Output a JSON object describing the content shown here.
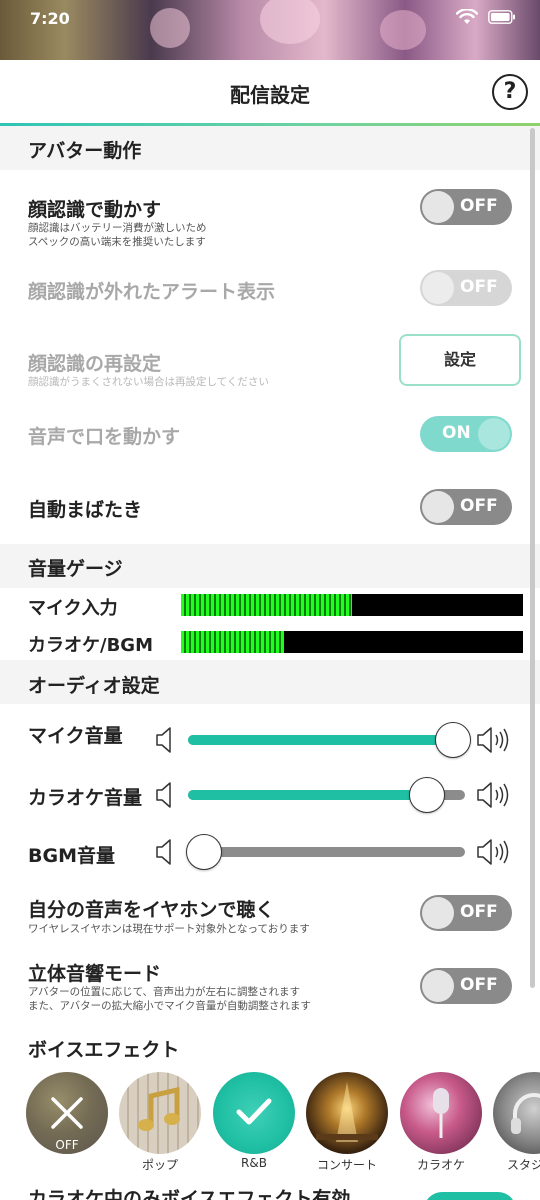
{
  "status": {
    "time": "7:20"
  },
  "header": {
    "title": "配信設定",
    "help": "?"
  },
  "sections": {
    "avatar": "アバター動作",
    "meter": "音量ゲージ",
    "audio": "オーディオ設定",
    "voice_effect": "ボイスエフェクト"
  },
  "avatar": {
    "face_move": {
      "title": "顔認識で動かす",
      "desc1": "顔認識はバッテリー消費が激しいため",
      "desc2": "スペックの高い端末を推奨いたします",
      "state": "OFF"
    },
    "face_alert": {
      "title": "顔認識が外れたアラート表示",
      "state": "OFF"
    },
    "face_reset": {
      "title": "顔認識の再設定",
      "desc": "顔認識がうまくされない場合は再設定してください",
      "button": "設定"
    },
    "mouth": {
      "title": "音声で口を動かす",
      "state": "ON"
    },
    "blink": {
      "title": "自動まばたき",
      "state": "OFF"
    }
  },
  "meters": {
    "mic": {
      "label": "マイク入力",
      "level": 0.5
    },
    "karaoke": {
      "label": "カラオケ/BGM",
      "level": 0.3
    }
  },
  "audio": {
    "mic_volume": {
      "label": "マイク音量",
      "value": 1.0
    },
    "karaoke_volume": {
      "label": "カラオケ音量",
      "value": 0.9
    },
    "bgm_volume": {
      "label": "BGM音量",
      "value": 0.06
    },
    "monitor": {
      "title": "自分の音声をイヤホンで聴く",
      "desc": "ワイヤレスイヤホンは現在サポート対象外となっております",
      "state": "OFF"
    },
    "stereo": {
      "title": "立体音響モード",
      "desc1": "アバターの位置に応じて、音声出力が左右に調整されます",
      "desc2": "また、アバターの拡大縮小でマイク音量が自動調整されます",
      "state": "OFF"
    }
  },
  "effects": [
    {
      "label": "OFF",
      "icon": "close-icon",
      "selected": false
    },
    {
      "label": "ポップ",
      "icon": "music-note-icon",
      "selected": false
    },
    {
      "label": "R&B",
      "icon": "check-icon",
      "selected": true
    },
    {
      "label": "コンサート",
      "icon": "stage-icon",
      "selected": false
    },
    {
      "label": "カラオケ",
      "icon": "microphone-icon",
      "selected": false
    },
    {
      "label": "スタジ",
      "icon": "headphones-icon",
      "selected": false
    }
  ],
  "bottom": {
    "title": "カラオケ中のみボイスエフェクト有効"
  },
  "colors": {
    "accent": "#1fbfa3",
    "meter_green": "#1fff1f",
    "toggle_off": "#8a8a8a"
  }
}
